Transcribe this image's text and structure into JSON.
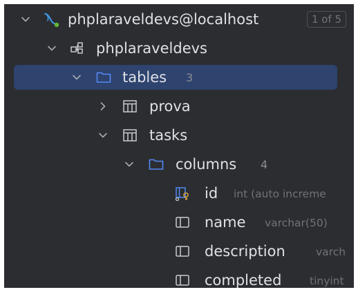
{
  "tree": {
    "datasource": {
      "label": "phplaraveldevs@localhost",
      "badge": "1 of 5"
    },
    "schema": {
      "label": "phplaraveldevs"
    },
    "tables_folder": {
      "label": "tables",
      "count": "3"
    },
    "tables": [
      {
        "label": "prova"
      },
      {
        "label": "tasks"
      }
    ],
    "columns_folder": {
      "label": "columns",
      "count": "4"
    },
    "columns": [
      {
        "name": "id",
        "type": "int (auto increme"
      },
      {
        "name": "name",
        "type": "varchar(50)"
      },
      {
        "name": "description",
        "type": "varch"
      },
      {
        "name": "completed",
        "type": "tinyint"
      }
    ]
  },
  "colors": {
    "panel_bg": "#2b2d30",
    "selection_bg": "#2e436e",
    "text": "#dfe1e5",
    "muted": "#8c8f94",
    "datasource_icon": "#3d9be9",
    "key_icon": "#d6a341"
  }
}
